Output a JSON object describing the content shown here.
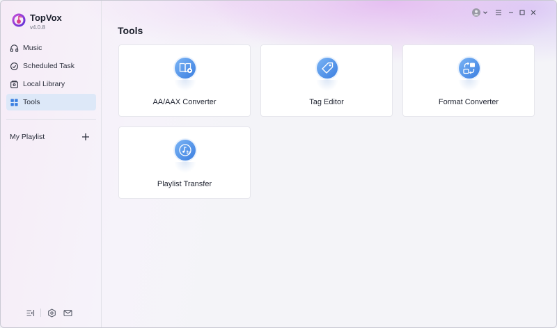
{
  "app": {
    "name": "TopVox",
    "version": "v4.0.8",
    "accent": "#3b7fe0"
  },
  "sidebar": {
    "items": [
      {
        "label": "Music",
        "icon": "headphones-icon"
      },
      {
        "label": "Scheduled Task",
        "icon": "clock-icon"
      },
      {
        "label": "Local Library",
        "icon": "library-icon"
      },
      {
        "label": "Tools",
        "icon": "grid-icon",
        "active": true
      }
    ],
    "playlist_label": "My Playlist",
    "footer": [
      "collapse-sidebar-icon",
      "settings-icon",
      "mail-icon"
    ]
  },
  "main": {
    "title": "Tools",
    "tools": [
      {
        "label": "AA/AAX Converter",
        "icon": "book-convert-icon"
      },
      {
        "label": "Tag Editor",
        "icon": "tag-icon"
      },
      {
        "label": "Format Converter",
        "icon": "format-convert-icon"
      },
      {
        "label": "Playlist Transfer",
        "icon": "playlist-transfer-icon"
      }
    ]
  },
  "window_controls": [
    "account-icon",
    "menu-icon",
    "minimize-icon",
    "maximize-icon",
    "close-icon"
  ]
}
